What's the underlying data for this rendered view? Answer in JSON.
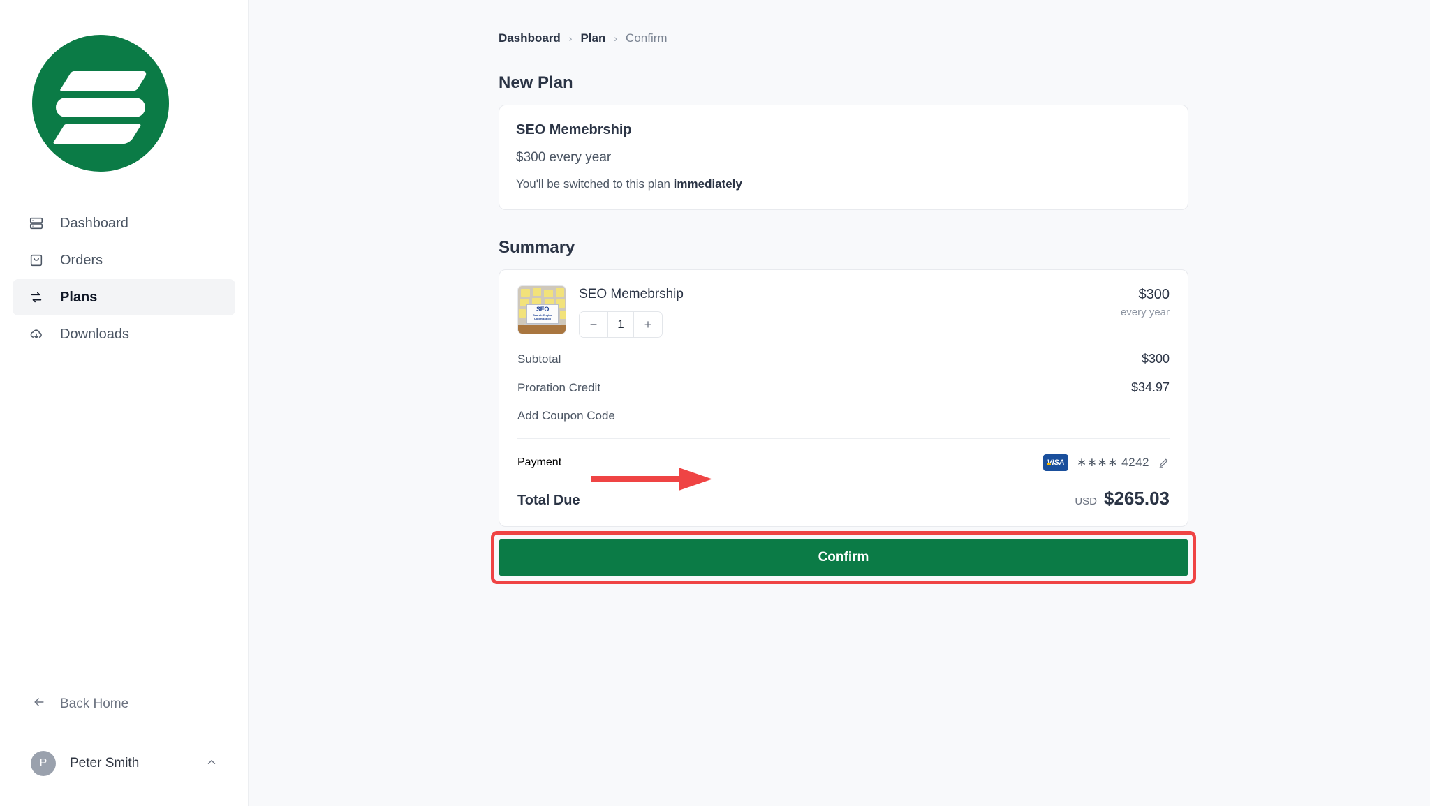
{
  "brand": {
    "logo_name": "company-logo",
    "green": "#0b7b46"
  },
  "sidebar": {
    "items": [
      {
        "label": "Dashboard",
        "icon": "server-icon",
        "active": false
      },
      {
        "label": "Orders",
        "icon": "shopping-bag-icon",
        "active": false
      },
      {
        "label": "Plans",
        "icon": "swap-arrows-icon",
        "active": true
      },
      {
        "label": "Downloads",
        "icon": "cloud-download-icon",
        "active": false
      }
    ],
    "back_home": {
      "label": "Back Home",
      "icon": "arrow-left-icon"
    },
    "user": {
      "initial": "P",
      "name": "Peter Smith",
      "chevron": "chevron-up-icon"
    }
  },
  "breadcrumb": {
    "items": [
      "Dashboard",
      "Plan",
      "Confirm"
    ],
    "separator": "›"
  },
  "new_plan": {
    "heading": "New Plan",
    "name": "SEO Memebrship",
    "price": "$300 every year",
    "note_prefix": "You'll be switched to this plan ",
    "note_emphasis": "immediately"
  },
  "summary": {
    "heading": "Summary",
    "item": {
      "name": "SEO Memebrship",
      "thumbnail_alt": "SEO laptop with sticky notes",
      "quantity": "1",
      "decrement_label": "−",
      "increment_label": "+",
      "price": "$300",
      "period": "every year"
    },
    "lines": [
      {
        "label": "Subtotal",
        "value": "$300"
      },
      {
        "label": "Proration Credit",
        "value": "$34.97"
      }
    ],
    "coupon_label": "Add Coupon Code",
    "payment": {
      "label": "Payment",
      "brand": "VISA",
      "masked": "∗∗∗∗ 4242",
      "edit_icon": "pencil-icon"
    },
    "total": {
      "label": "Total Due",
      "currency": "USD",
      "amount": "$265.03"
    }
  },
  "confirm": {
    "label": "Confirm",
    "highlight_color": "#ef4444"
  },
  "annotation": {
    "arrow_color": "#ef4444",
    "arrow_name": "pointer-arrow"
  }
}
